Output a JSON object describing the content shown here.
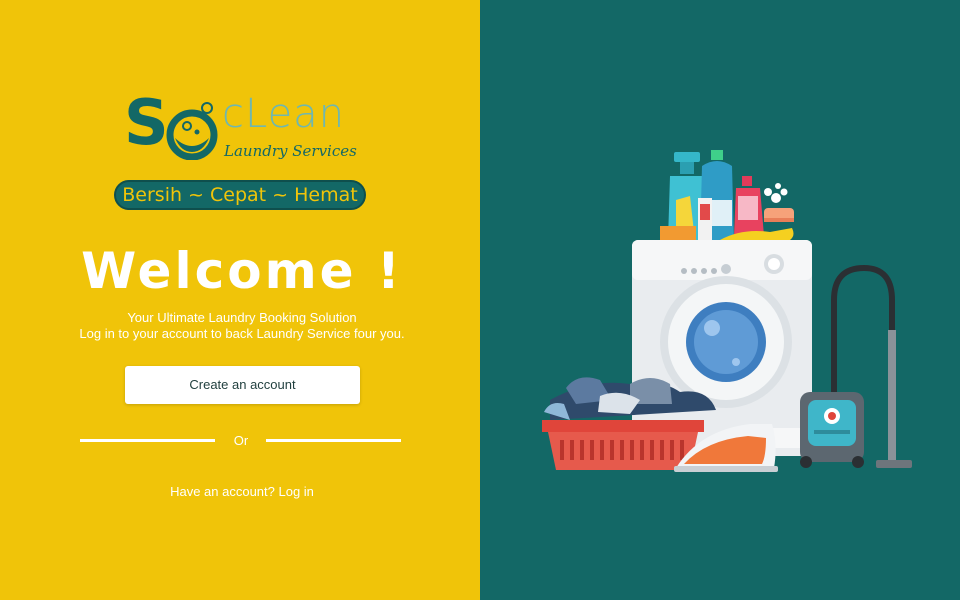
{
  "brand": {
    "logo_s": "S",
    "logo_clean": "cLean",
    "logo_subtitle": "Laundry Services",
    "tagline": "Bersih ~ Cepat ~ Hemat",
    "primary_color": "#136866",
    "accent_color": "#F0C409"
  },
  "hero": {
    "title": "Welcome !",
    "subtitle_line1": "Your Ultimate Laundry Booking Solution",
    "subtitle_line2": "Log in  to your account to back Laundry Service four you."
  },
  "actions": {
    "create_account_label": "Create an account",
    "divider_label": "Or",
    "login_prompt": "Have an account? Log in"
  },
  "illustration": {
    "items": [
      "spray-bottle",
      "detergent-bottles",
      "rubber-glove",
      "washing-machine",
      "laundry-basket",
      "iron",
      "vacuum-cleaner"
    ]
  }
}
